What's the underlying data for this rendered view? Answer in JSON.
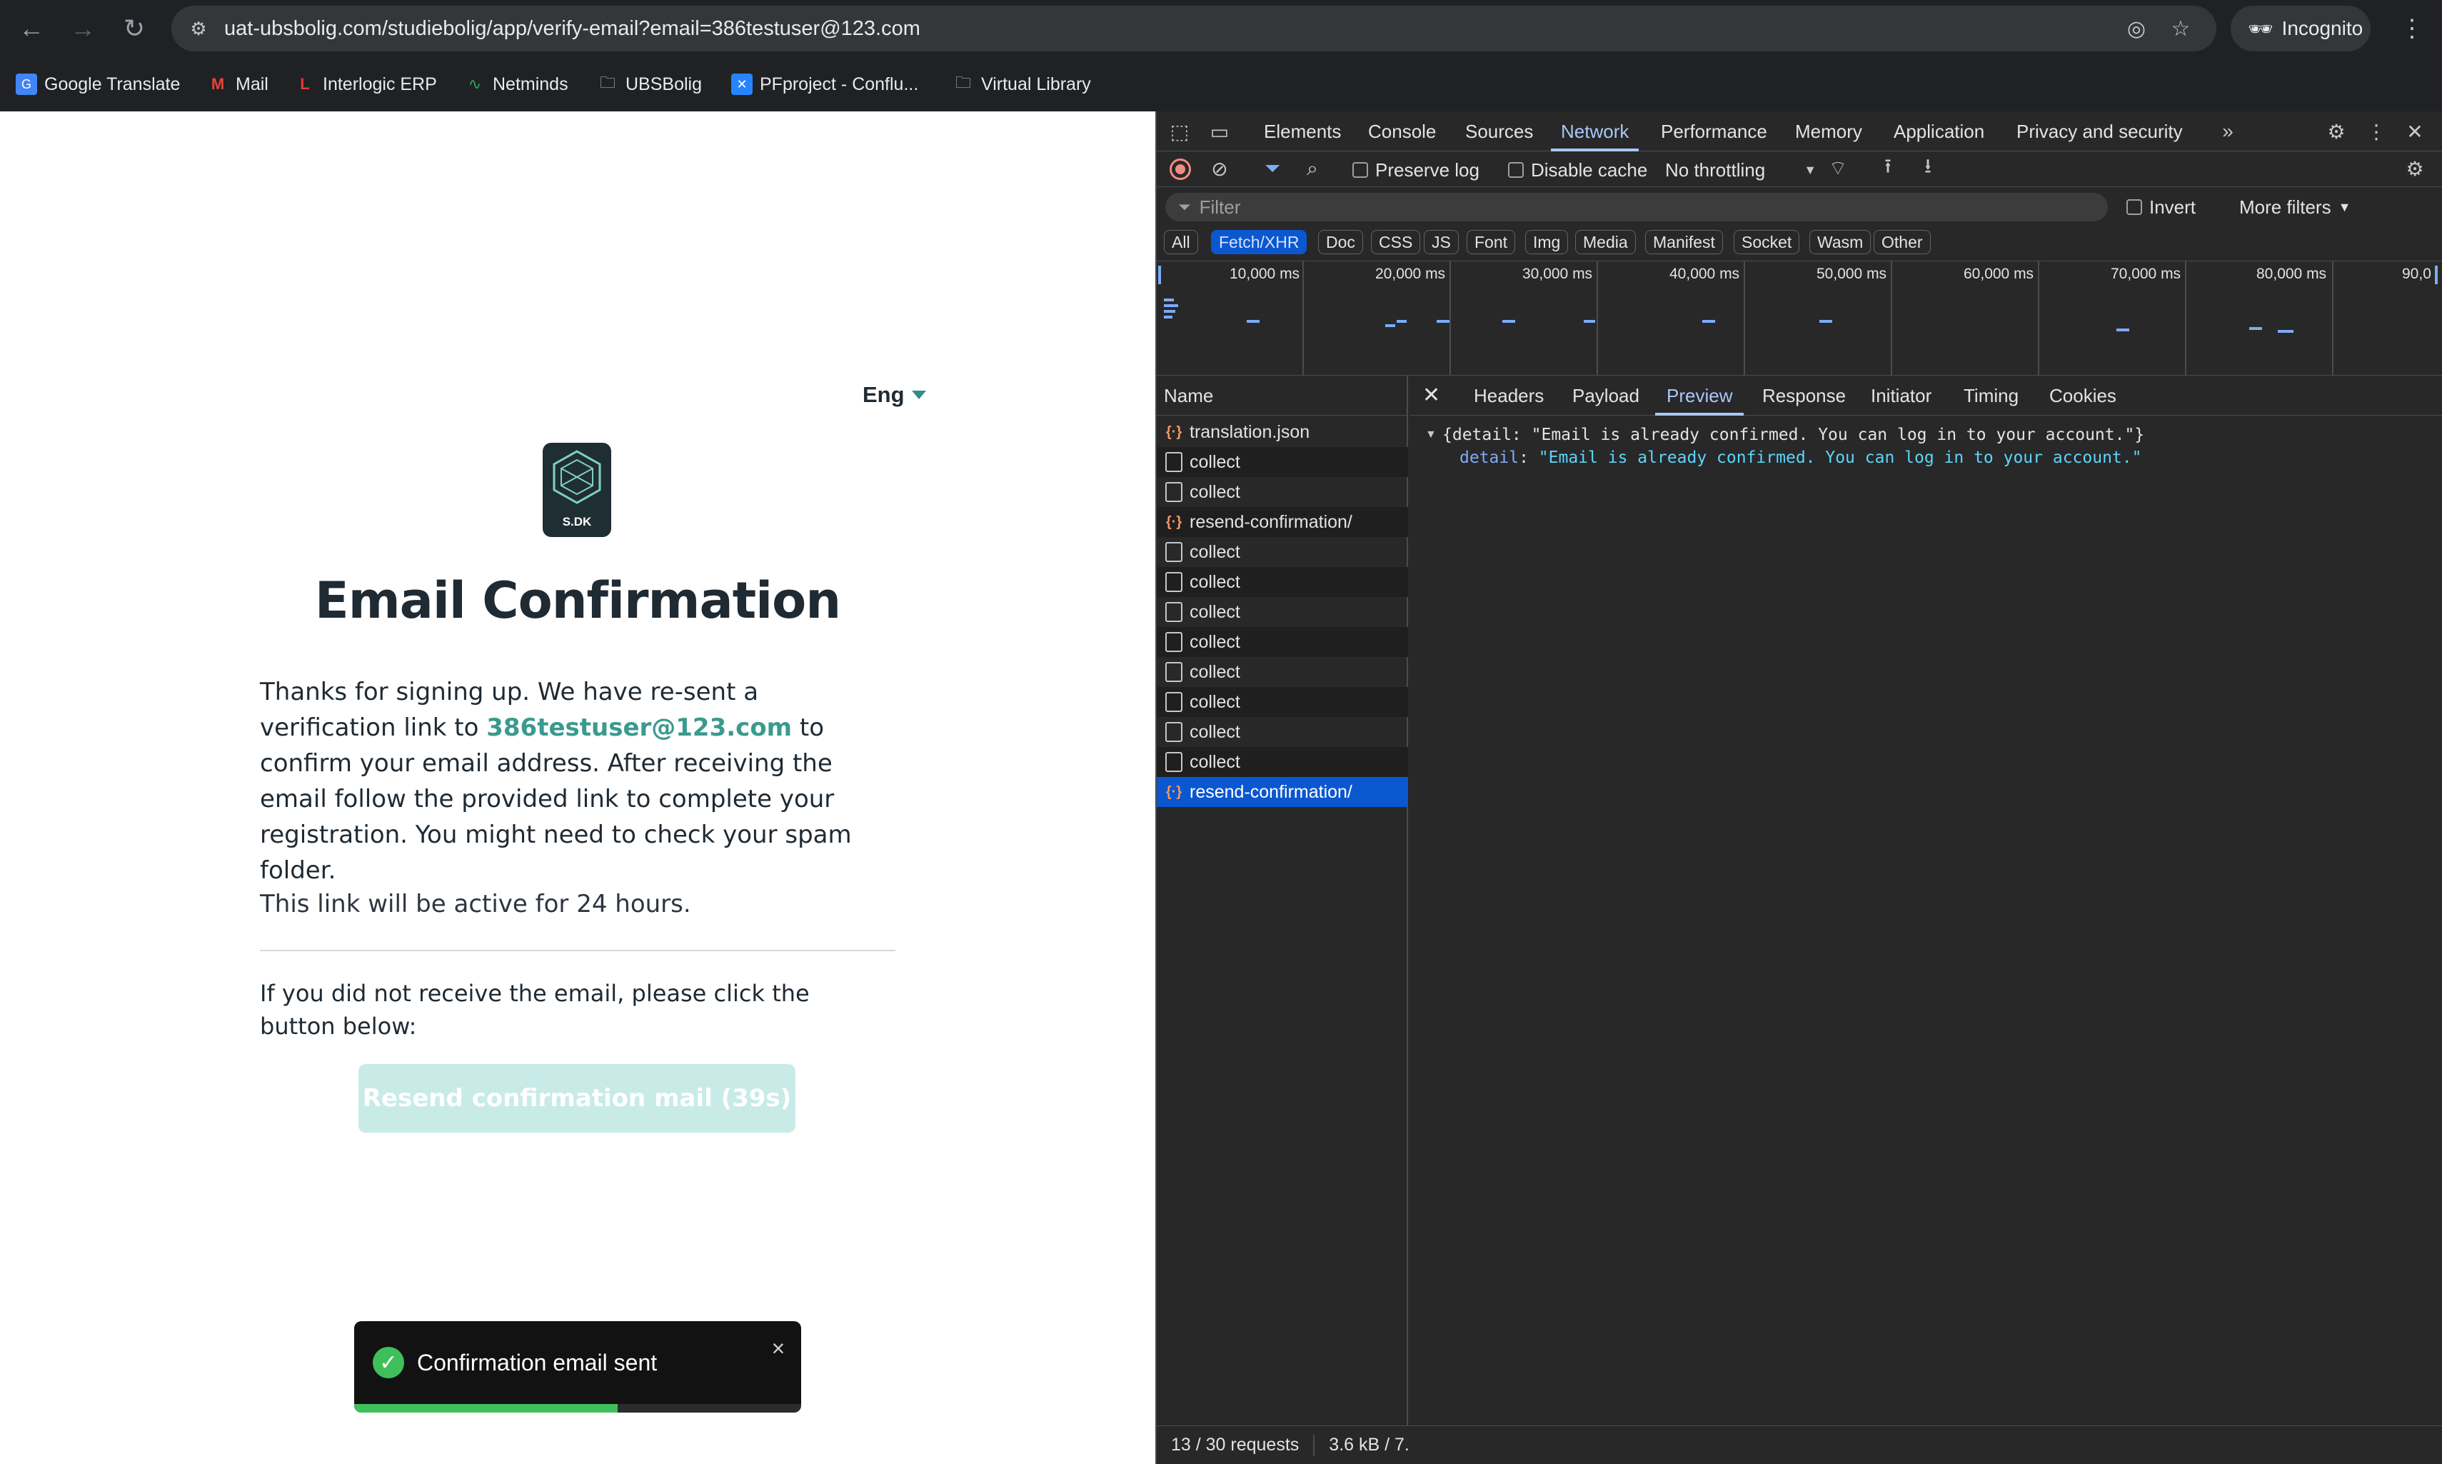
{
  "browser": {
    "url": "uat-ubsbolig.com/studiebolig/app/verify-email?email=386testuser@123.com",
    "profile_label": "Incognito"
  },
  "bookmarks": [
    {
      "label": "Google Translate",
      "icon": "google-translate-icon"
    },
    {
      "label": "Mail",
      "icon": "gmail-icon"
    },
    {
      "label": "Interlogic ERP",
      "icon": "interlogic-icon"
    },
    {
      "label": "Netminds",
      "icon": "netminds-icon"
    },
    {
      "label": "UBSBolig",
      "icon": "folder-icon"
    },
    {
      "label": "PFproject - Conflu...",
      "icon": "confluence-icon"
    },
    {
      "label": "Virtual Library",
      "icon": "folder-icon"
    }
  ],
  "page": {
    "language": "Eng",
    "logo_text": "S.DK",
    "title": "Email Confirmation",
    "para_before": "Thanks for signing up. We have re-sent a verification link to ",
    "email": "386testuser@123.com",
    "para_after": " to confirm your email address. After receiving the email follow the provided link to complete your registration. You might need to check your spam folder.",
    "active_note": "This link will be active for 24 hours.",
    "not_received": "If you did not receive the email, please click the button below:",
    "resend_button": "Resend confirmation mail (39s)",
    "toast": {
      "text": "Confirmation email sent",
      "progress": 0.59
    }
  },
  "devtools": {
    "tabs": [
      "Elements",
      "Console",
      "Sources",
      "Network",
      "Performance",
      "Memory",
      "Application",
      "Privacy and security"
    ],
    "active_tab": "Network",
    "toolbar": {
      "preserve_log": "Preserve log",
      "disable_cache": "Disable cache",
      "throttling": "No throttling"
    },
    "filter_placeholder": "Filter",
    "invert": "Invert",
    "more_filters": "More filters",
    "type_filters": [
      "All",
      "Fetch/XHR",
      "Doc",
      "CSS",
      "JS",
      "Font",
      "Img",
      "Media",
      "Manifest",
      "Socket",
      "Wasm",
      "Other"
    ],
    "active_type": "Fetch/XHR",
    "timeline_labels": [
      "10,000 ms",
      "20,000 ms",
      "30,000 ms",
      "40,000 ms",
      "50,000 ms",
      "60,000 ms",
      "70,000 ms",
      "80,000 ms",
      "90,0"
    ],
    "name_header": "Name",
    "requests": [
      {
        "name": "translation.json",
        "type": "xhr"
      },
      {
        "name": "collect",
        "type": "doc"
      },
      {
        "name": "collect",
        "type": "doc"
      },
      {
        "name": "resend-confirmation/",
        "type": "xhr"
      },
      {
        "name": "collect",
        "type": "doc"
      },
      {
        "name": "collect",
        "type": "doc"
      },
      {
        "name": "collect",
        "type": "doc"
      },
      {
        "name": "collect",
        "type": "doc"
      },
      {
        "name": "collect",
        "type": "doc"
      },
      {
        "name": "collect",
        "type": "doc"
      },
      {
        "name": "collect",
        "type": "doc"
      },
      {
        "name": "collect",
        "type": "doc"
      },
      {
        "name": "resend-confirmation/",
        "type": "xhr"
      }
    ],
    "selected_request": 12,
    "detail_tabs": [
      "Headers",
      "Payload",
      "Preview",
      "Response",
      "Initiator",
      "Timing",
      "Cookies"
    ],
    "active_detail_tab": "Preview",
    "preview_line1": "{detail: \"Email is already confirmed. You can log in to your account.\"}",
    "preview_key": "detail",
    "preview_value": "\"Email is already confirmed. You can log in to your account.\"",
    "status": {
      "requests": "13 / 30 requests",
      "transferred": "3.6 kB / 7."
    }
  }
}
